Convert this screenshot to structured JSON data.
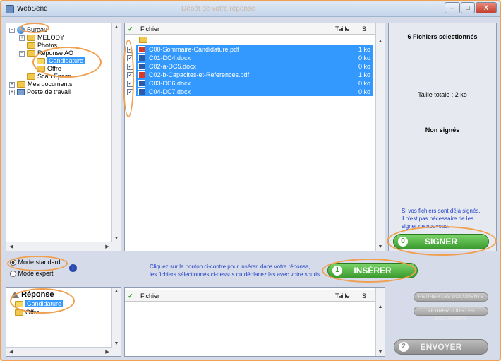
{
  "window": {
    "title": "WebSend",
    "faded_title": "Dépôt de votre réponse",
    "buttons": {
      "minimize": "–",
      "maximize": "□",
      "close": "X"
    }
  },
  "tree": [
    {
      "label": "Bureau",
      "icon": "desktop-globe-icon",
      "expander": "−",
      "level": 0
    },
    {
      "label": "MELODY",
      "icon": "folder-icon",
      "expander": "+",
      "level": 1
    },
    {
      "label": "Photos",
      "icon": "folder-icon",
      "expander": "",
      "level": 1
    },
    {
      "label": "Reponse AO",
      "icon": "folder-icon",
      "expander": "−",
      "level": 1
    },
    {
      "label": "Candidature",
      "icon": "open-folder-icon",
      "expander": "",
      "level": 2,
      "selected": true
    },
    {
      "label": "Offre",
      "icon": "folder-icon",
      "expander": "",
      "level": 2
    },
    {
      "label": "Scan Epson",
      "icon": "folder-icon",
      "expander": "",
      "level": 1
    },
    {
      "label": "Mes documents",
      "icon": "folder-icon",
      "expander": "+",
      "level": 0
    },
    {
      "label": "Poste de travail",
      "icon": "computer-icon",
      "expander": "+",
      "level": 0
    }
  ],
  "files_header": {
    "check": "✓",
    "name": "Fichier",
    "size": "Taille",
    "signed": "S"
  },
  "files_parent": "..",
  "files": [
    {
      "name": "C00-Sommaire-Candidature.pdf",
      "size": "1 ko",
      "type": "pdf",
      "checked": "✓"
    },
    {
      "name": "C01-DC4.docx",
      "size": "0 ko",
      "type": "doc",
      "checked": "✓"
    },
    {
      "name": "C02-a-DC5.docx",
      "size": "0 ko",
      "type": "doc",
      "checked": "✓"
    },
    {
      "name": "C02-b-Capacites-et-References.pdf",
      "size": "1 ko",
      "type": "pdf",
      "checked": "✓"
    },
    {
      "name": "C03-DC6.docx",
      "size": "0 ko",
      "type": "doc",
      "checked": "✓"
    },
    {
      "name": "C04-DC7.docx",
      "size": "0 ko",
      "type": "doc",
      "checked": "✓"
    }
  ],
  "side": {
    "selected_count": "6 Fichiers sélectionnés",
    "total_size": "Taille totale : 2 ko",
    "sign_status": "Non signés",
    "note_lines": [
      "Si vos fichiers sont déjà signés,",
      "il n'est pas nécessaire de les",
      "signer de nouveau."
    ],
    "sign_button": {
      "number": "0",
      "label": "SIGNER"
    }
  },
  "mode": {
    "standard": "Mode standard",
    "expert": "Mode expert",
    "info_icon": "i",
    "instruction_lines": [
      "Cliquez sur le bouton ci-contre pour insérer, dans votre réponse,",
      "les fichiers sélectionnés ci-dessus ou déplacez les avec votre souris."
    ],
    "insert_button": {
      "number": "1",
      "label": "INSÉRER"
    }
  },
  "response_tree": {
    "root": "Réponse",
    "children": [
      {
        "label": "Candidature",
        "selected": true
      },
      {
        "label": "Offre",
        "selected": false
      }
    ]
  },
  "response_header": {
    "check": "✓",
    "name": "Fichier",
    "size": "Taille",
    "signed": "S"
  },
  "actions": {
    "remove_docs": "RETIRER LES DOCUMENTS",
    "remove_all": "RETIRER TOUS LES DOCUMENTS",
    "send_button": {
      "number": "2",
      "label": "ENVOYER"
    }
  },
  "colors": {
    "selection": "#3399ff",
    "accent_orange": "#f0a050",
    "green_button": "#3a9a2e"
  }
}
